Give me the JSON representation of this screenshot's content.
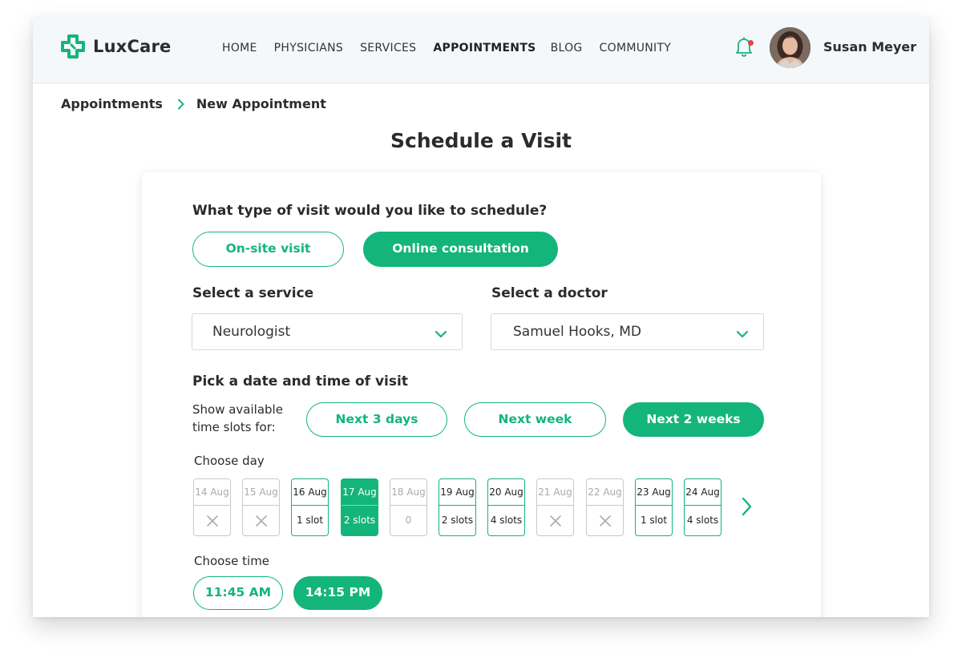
{
  "brand": {
    "name": "LuxCare",
    "accent": "#13b57b"
  },
  "nav": {
    "links": [
      "HOME",
      "PHYSICIANS",
      "SERVICES",
      "APPOINTMENTS",
      "BLOG",
      "COMMUNITY"
    ],
    "active": "APPOINTMENTS"
  },
  "user": {
    "name": "Susan Meyer",
    "has_notification": true
  },
  "breadcrumb": {
    "parent": "Appointments",
    "current": "New Appointment"
  },
  "page_title": "Schedule a Visit",
  "visit_type": {
    "question": "What type of visit would you like to schedule?",
    "options": [
      "On-site visit",
      "Online consultation"
    ],
    "selected": "Online consultation"
  },
  "service": {
    "label": "Select a service",
    "value": "Neurologist"
  },
  "doctor": {
    "label": "Select a doctor",
    "value": "Samuel Hooks, MD"
  },
  "schedule": {
    "title": "Pick a date and time of visit",
    "range_label_line1": "Show available",
    "range_label_line2": "time slots for:",
    "ranges": [
      "Next 3 days",
      "Next week",
      "Next 2 weeks"
    ],
    "selected_range": "Next 2 weeks",
    "day_label": "Choose day",
    "days": [
      {
        "date": "14 Aug",
        "slots": "",
        "status": "unavailable"
      },
      {
        "date": "15 Aug",
        "slots": "",
        "status": "unavailable"
      },
      {
        "date": "16 Aug",
        "slots": "1 slot",
        "status": "available"
      },
      {
        "date": "17 Aug",
        "slots": "2 slots",
        "status": "selected"
      },
      {
        "date": "18 Aug",
        "slots": "0",
        "status": "empty"
      },
      {
        "date": "19 Aug",
        "slots": "2 slots",
        "status": "available"
      },
      {
        "date": "20 Aug",
        "slots": "4 slots",
        "status": "available"
      },
      {
        "date": "21 Aug",
        "slots": "",
        "status": "unavailable"
      },
      {
        "date": "22 Aug",
        "slots": "",
        "status": "unavailable"
      },
      {
        "date": "23 Aug",
        "slots": "1 slot",
        "status": "available"
      },
      {
        "date": "24 Aug",
        "slots": "4 slots",
        "status": "available"
      }
    ],
    "time_label": "Choose time",
    "times": [
      "11:45 AM",
      "14:15 PM"
    ],
    "selected_time": "14:15 PM"
  },
  "icons": {
    "logo": "cross-logo-icon",
    "notification": "bell-icon",
    "breadcrumb_separator": "chevron-right-icon",
    "select": "chevron-down-icon",
    "unavailable_day": "x-icon",
    "next_days": "chevron-right-icon"
  }
}
